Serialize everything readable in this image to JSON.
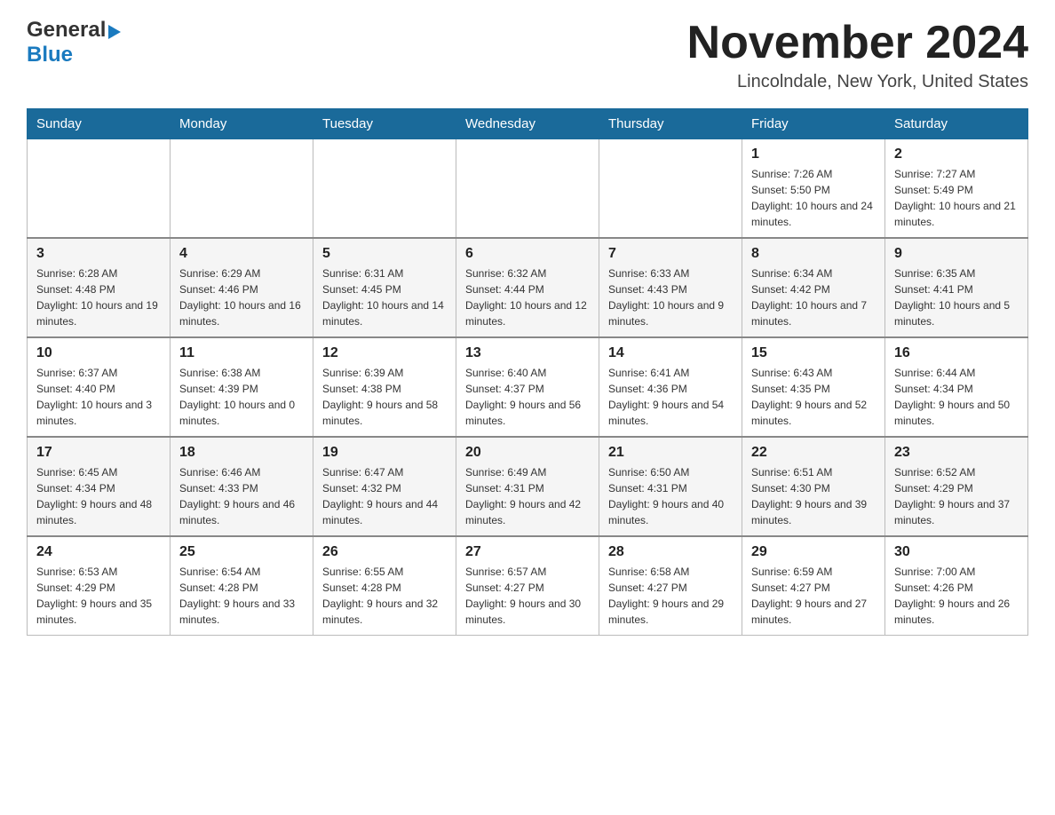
{
  "header": {
    "logo_general": "General",
    "logo_blue": "Blue",
    "month_title": "November 2024",
    "location": "Lincolndale, New York, United States"
  },
  "weekdays": [
    "Sunday",
    "Monday",
    "Tuesday",
    "Wednesday",
    "Thursday",
    "Friday",
    "Saturday"
  ],
  "weeks": [
    [
      {
        "day": "",
        "sunrise": "",
        "sunset": "",
        "daylight": ""
      },
      {
        "day": "",
        "sunrise": "",
        "sunset": "",
        "daylight": ""
      },
      {
        "day": "",
        "sunrise": "",
        "sunset": "",
        "daylight": ""
      },
      {
        "day": "",
        "sunrise": "",
        "sunset": "",
        "daylight": ""
      },
      {
        "day": "",
        "sunrise": "",
        "sunset": "",
        "daylight": ""
      },
      {
        "day": "1",
        "sunrise": "Sunrise: 7:26 AM",
        "sunset": "Sunset: 5:50 PM",
        "daylight": "Daylight: 10 hours and 24 minutes."
      },
      {
        "day": "2",
        "sunrise": "Sunrise: 7:27 AM",
        "sunset": "Sunset: 5:49 PM",
        "daylight": "Daylight: 10 hours and 21 minutes."
      }
    ],
    [
      {
        "day": "3",
        "sunrise": "Sunrise: 6:28 AM",
        "sunset": "Sunset: 4:48 PM",
        "daylight": "Daylight: 10 hours and 19 minutes."
      },
      {
        "day": "4",
        "sunrise": "Sunrise: 6:29 AM",
        "sunset": "Sunset: 4:46 PM",
        "daylight": "Daylight: 10 hours and 16 minutes."
      },
      {
        "day": "5",
        "sunrise": "Sunrise: 6:31 AM",
        "sunset": "Sunset: 4:45 PM",
        "daylight": "Daylight: 10 hours and 14 minutes."
      },
      {
        "day": "6",
        "sunrise": "Sunrise: 6:32 AM",
        "sunset": "Sunset: 4:44 PM",
        "daylight": "Daylight: 10 hours and 12 minutes."
      },
      {
        "day": "7",
        "sunrise": "Sunrise: 6:33 AM",
        "sunset": "Sunset: 4:43 PM",
        "daylight": "Daylight: 10 hours and 9 minutes."
      },
      {
        "day": "8",
        "sunrise": "Sunrise: 6:34 AM",
        "sunset": "Sunset: 4:42 PM",
        "daylight": "Daylight: 10 hours and 7 minutes."
      },
      {
        "day": "9",
        "sunrise": "Sunrise: 6:35 AM",
        "sunset": "Sunset: 4:41 PM",
        "daylight": "Daylight: 10 hours and 5 minutes."
      }
    ],
    [
      {
        "day": "10",
        "sunrise": "Sunrise: 6:37 AM",
        "sunset": "Sunset: 4:40 PM",
        "daylight": "Daylight: 10 hours and 3 minutes."
      },
      {
        "day": "11",
        "sunrise": "Sunrise: 6:38 AM",
        "sunset": "Sunset: 4:39 PM",
        "daylight": "Daylight: 10 hours and 0 minutes."
      },
      {
        "day": "12",
        "sunrise": "Sunrise: 6:39 AM",
        "sunset": "Sunset: 4:38 PM",
        "daylight": "Daylight: 9 hours and 58 minutes."
      },
      {
        "day": "13",
        "sunrise": "Sunrise: 6:40 AM",
        "sunset": "Sunset: 4:37 PM",
        "daylight": "Daylight: 9 hours and 56 minutes."
      },
      {
        "day": "14",
        "sunrise": "Sunrise: 6:41 AM",
        "sunset": "Sunset: 4:36 PM",
        "daylight": "Daylight: 9 hours and 54 minutes."
      },
      {
        "day": "15",
        "sunrise": "Sunrise: 6:43 AM",
        "sunset": "Sunset: 4:35 PM",
        "daylight": "Daylight: 9 hours and 52 minutes."
      },
      {
        "day": "16",
        "sunrise": "Sunrise: 6:44 AM",
        "sunset": "Sunset: 4:34 PM",
        "daylight": "Daylight: 9 hours and 50 minutes."
      }
    ],
    [
      {
        "day": "17",
        "sunrise": "Sunrise: 6:45 AM",
        "sunset": "Sunset: 4:34 PM",
        "daylight": "Daylight: 9 hours and 48 minutes."
      },
      {
        "day": "18",
        "sunrise": "Sunrise: 6:46 AM",
        "sunset": "Sunset: 4:33 PM",
        "daylight": "Daylight: 9 hours and 46 minutes."
      },
      {
        "day": "19",
        "sunrise": "Sunrise: 6:47 AM",
        "sunset": "Sunset: 4:32 PM",
        "daylight": "Daylight: 9 hours and 44 minutes."
      },
      {
        "day": "20",
        "sunrise": "Sunrise: 6:49 AM",
        "sunset": "Sunset: 4:31 PM",
        "daylight": "Daylight: 9 hours and 42 minutes."
      },
      {
        "day": "21",
        "sunrise": "Sunrise: 6:50 AM",
        "sunset": "Sunset: 4:31 PM",
        "daylight": "Daylight: 9 hours and 40 minutes."
      },
      {
        "day": "22",
        "sunrise": "Sunrise: 6:51 AM",
        "sunset": "Sunset: 4:30 PM",
        "daylight": "Daylight: 9 hours and 39 minutes."
      },
      {
        "day": "23",
        "sunrise": "Sunrise: 6:52 AM",
        "sunset": "Sunset: 4:29 PM",
        "daylight": "Daylight: 9 hours and 37 minutes."
      }
    ],
    [
      {
        "day": "24",
        "sunrise": "Sunrise: 6:53 AM",
        "sunset": "Sunset: 4:29 PM",
        "daylight": "Daylight: 9 hours and 35 minutes."
      },
      {
        "day": "25",
        "sunrise": "Sunrise: 6:54 AM",
        "sunset": "Sunset: 4:28 PM",
        "daylight": "Daylight: 9 hours and 33 minutes."
      },
      {
        "day": "26",
        "sunrise": "Sunrise: 6:55 AM",
        "sunset": "Sunset: 4:28 PM",
        "daylight": "Daylight: 9 hours and 32 minutes."
      },
      {
        "day": "27",
        "sunrise": "Sunrise: 6:57 AM",
        "sunset": "Sunset: 4:27 PM",
        "daylight": "Daylight: 9 hours and 30 minutes."
      },
      {
        "day": "28",
        "sunrise": "Sunrise: 6:58 AM",
        "sunset": "Sunset: 4:27 PM",
        "daylight": "Daylight: 9 hours and 29 minutes."
      },
      {
        "day": "29",
        "sunrise": "Sunrise: 6:59 AM",
        "sunset": "Sunset: 4:27 PM",
        "daylight": "Daylight: 9 hours and 27 minutes."
      },
      {
        "day": "30",
        "sunrise": "Sunrise: 7:00 AM",
        "sunset": "Sunset: 4:26 PM",
        "daylight": "Daylight: 9 hours and 26 minutes."
      }
    ]
  ]
}
